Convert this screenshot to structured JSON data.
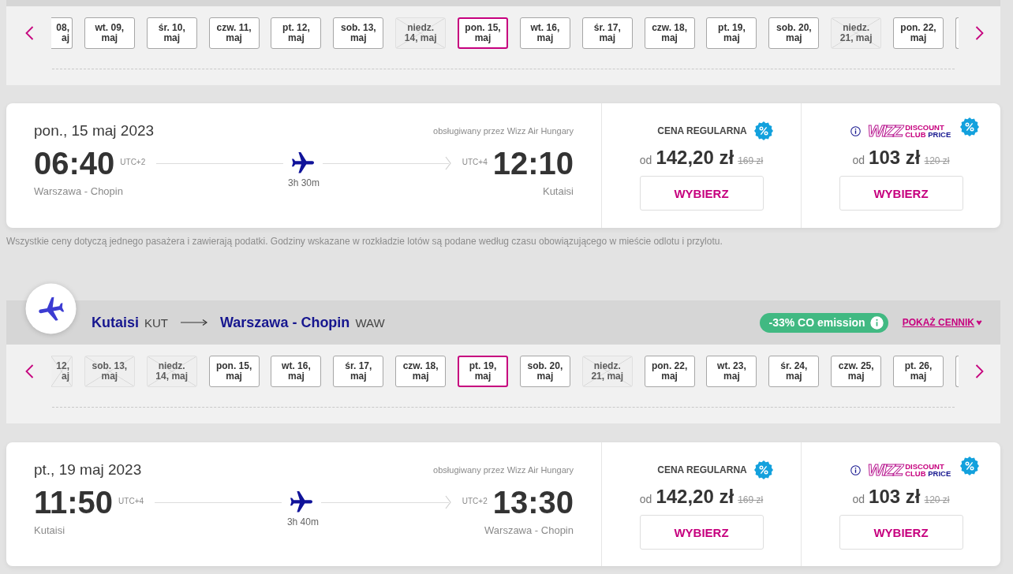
{
  "outbound": {
    "dates": [
      {
        "kind": "partial",
        "label": "08, aj",
        "selected": false,
        "disabled": false
      },
      {
        "kind": "full",
        "label": "wt. 09, maj",
        "selected": false,
        "disabled": false
      },
      {
        "kind": "full",
        "label": "śr. 10, maj",
        "selected": false,
        "disabled": false
      },
      {
        "kind": "full",
        "label": "czw. 11, maj",
        "selected": false,
        "disabled": false
      },
      {
        "kind": "full",
        "label": "pt. 12, maj",
        "selected": false,
        "disabled": false
      },
      {
        "kind": "full",
        "label": "sob. 13, maj",
        "selected": false,
        "disabled": false
      },
      {
        "kind": "full",
        "label": "niedz. 14, maj",
        "selected": false,
        "disabled": true
      },
      {
        "kind": "full",
        "label": "pon. 15, maj",
        "selected": true,
        "disabled": false
      },
      {
        "kind": "full",
        "label": "wt. 16, maj",
        "selected": false,
        "disabled": false
      },
      {
        "kind": "full",
        "label": "śr. 17, maj",
        "selected": false,
        "disabled": false
      },
      {
        "kind": "full",
        "label": "czw. 18, maj",
        "selected": false,
        "disabled": false
      },
      {
        "kind": "full",
        "label": "pt. 19, maj",
        "selected": false,
        "disabled": false
      },
      {
        "kind": "full",
        "label": "sob. 20, maj",
        "selected": false,
        "disabled": false
      },
      {
        "kind": "full",
        "label": "niedz. 21, maj",
        "selected": false,
        "disabled": true
      },
      {
        "kind": "full",
        "label": "pon. 22, maj",
        "selected": false,
        "disabled": false
      },
      {
        "kind": "edge",
        "selected": false,
        "disabled": false
      }
    ],
    "flight": {
      "date": "pon., 15 maj 2023",
      "operator": "obsługiwany przez Wizz Air Hungary",
      "departure": {
        "time": "06:40",
        "utc": "UTC+2",
        "airport": "Warszawa - Chopin"
      },
      "duration": "3h 30m",
      "arrival": {
        "time": "12:10",
        "utc": "UTC+4",
        "airport": "Kutaisi"
      },
      "fares": [
        {
          "kind": "regular",
          "title": "CENA REGULARNA",
          "prefix": "od",
          "price": "142,20 zł",
          "old_price": "169 zł",
          "button": "WYBIERZ"
        },
        {
          "kind": "club",
          "wordmark": "WIZZ",
          "words": [
            {
              "text": "DISCOUNT",
              "kind": "accent"
            },
            {
              "text": "CLUB",
              "kind": "accent"
            },
            {
              "text": "PRICE",
              "kind": "plain"
            }
          ],
          "prefix": "od",
          "price": "103 zł",
          "old_price": "120 zł",
          "button": "WYBIERZ"
        }
      ]
    }
  },
  "footnote": "Wszystkie ceny dotyczą jednego pasażera i zawierają podatki. Godziny wskazane w rozkładzie lotów są podane według czasu obowiązującego w mieście odlotu i przylotu.",
  "return": {
    "route": {
      "origin": "Kutaisi",
      "origin_code": "KUT",
      "destination": "Warszawa - Chopin",
      "destination_code": "WAW"
    },
    "emission": "-33% CO emission",
    "price_link": "POKAŻ CENNIK",
    "dates": [
      {
        "kind": "partial",
        "label": "12, aj",
        "selected": false,
        "disabled": true
      },
      {
        "kind": "full",
        "label": "sob. 13, maj",
        "selected": false,
        "disabled": true
      },
      {
        "kind": "full",
        "label": "niedz. 14, maj",
        "selected": false,
        "disabled": true
      },
      {
        "kind": "full",
        "label": "pon. 15, maj",
        "selected": false,
        "disabled": false
      },
      {
        "kind": "full",
        "label": "wt. 16, maj",
        "selected": false,
        "disabled": false
      },
      {
        "kind": "full",
        "label": "śr. 17, maj",
        "selected": false,
        "disabled": false
      },
      {
        "kind": "full",
        "label": "czw. 18, maj",
        "selected": false,
        "disabled": false
      },
      {
        "kind": "full",
        "label": "pt. 19, maj",
        "selected": true,
        "disabled": false
      },
      {
        "kind": "full",
        "label": "sob. 20, maj",
        "selected": false,
        "disabled": false
      },
      {
        "kind": "full",
        "label": "niedz. 21, maj",
        "selected": false,
        "disabled": true
      },
      {
        "kind": "full",
        "label": "pon. 22, maj",
        "selected": false,
        "disabled": false
      },
      {
        "kind": "full",
        "label": "wt. 23, maj",
        "selected": false,
        "disabled": false
      },
      {
        "kind": "full",
        "label": "śr. 24, maj",
        "selected": false,
        "disabled": false
      },
      {
        "kind": "full",
        "label": "czw. 25, maj",
        "selected": false,
        "disabled": false
      },
      {
        "kind": "full",
        "label": "pt. 26, maj",
        "selected": false,
        "disabled": false
      },
      {
        "kind": "edge",
        "selected": false,
        "disabled": false
      }
    ],
    "flight": {
      "date": "pt., 19 maj 2023",
      "operator": "obsługiwany przez Wizz Air Hungary",
      "departure": {
        "time": "11:50",
        "utc": "UTC+4",
        "airport": "Kutaisi"
      },
      "duration": "3h 40m",
      "arrival": {
        "time": "13:30",
        "utc": "UTC+2",
        "airport": "Warszawa - Chopin"
      },
      "fares": [
        {
          "kind": "regular",
          "title": "CENA REGULARNA",
          "prefix": "od",
          "price": "142,20 zł",
          "old_price": "169 zł",
          "button": "WYBIERZ"
        },
        {
          "kind": "club",
          "wordmark": "WIZZ",
          "words": [
            {
              "text": "DISCOUNT",
              "kind": "accent"
            },
            {
              "text": "CLUB",
              "kind": "accent"
            },
            {
              "text": "PRICE",
              "kind": "plain"
            }
          ],
          "prefix": "od",
          "price": "103 zł",
          "old_price": "120 zł",
          "button": "WYBIERZ"
        }
      ]
    }
  }
}
